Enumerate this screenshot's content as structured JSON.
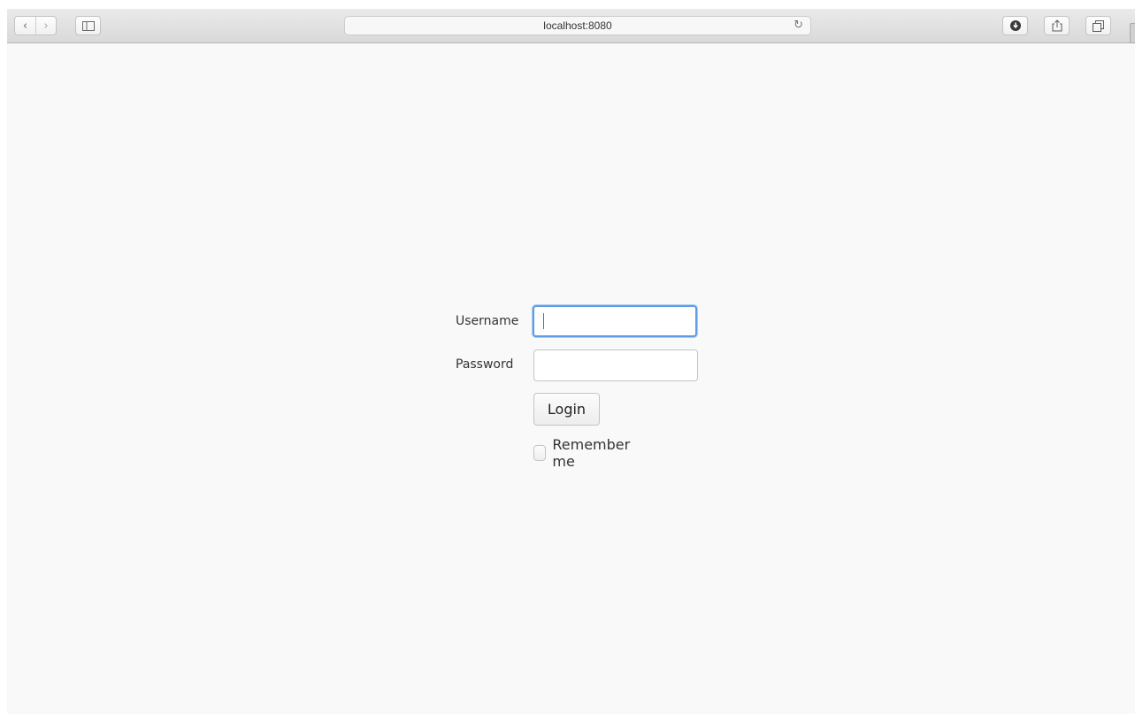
{
  "browser": {
    "url": "localhost:8080",
    "icons": {
      "back": "chevron-left-icon",
      "forward": "chevron-right-icon",
      "sidebar": "sidebar-icon",
      "reload": "reload-icon",
      "downloads": "download-icon",
      "share": "share-icon",
      "tabs": "tabs-icon"
    }
  },
  "login": {
    "username_label": "Username",
    "username_value": "",
    "password_label": "Password",
    "password_value": "",
    "login_button": "Login",
    "remember_label": "Remember me",
    "remember_checked": false
  },
  "colors": {
    "page_background": "#f9f9f9",
    "focus_ring": "#5e9de6"
  }
}
